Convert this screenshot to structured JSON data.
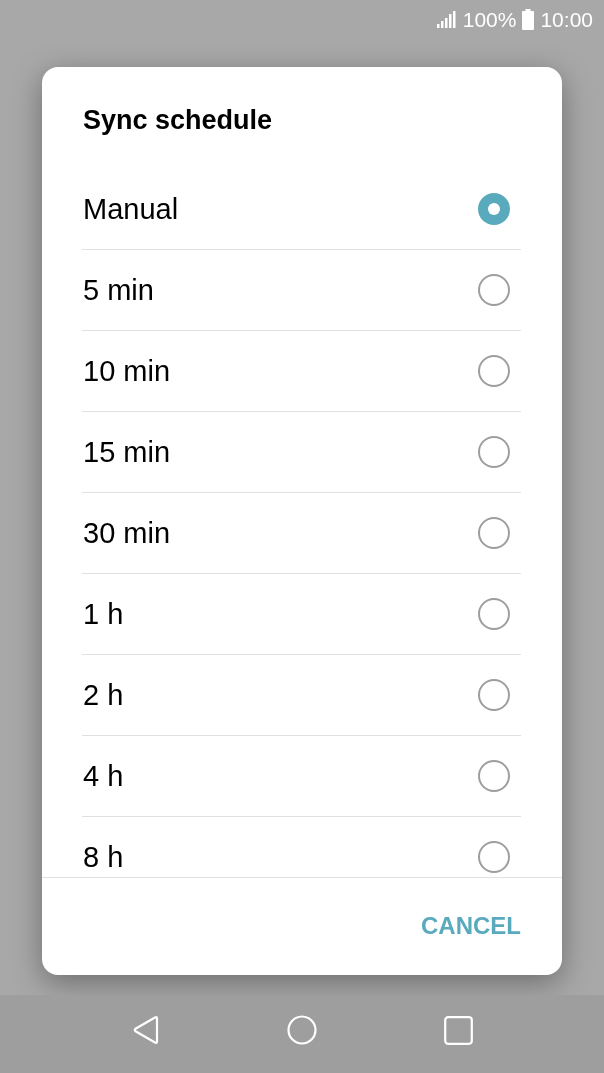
{
  "status_bar": {
    "battery": "100%",
    "time": "10:00"
  },
  "dialog": {
    "title": "Sync schedule",
    "options": [
      {
        "label": "Manual",
        "selected": true
      },
      {
        "label": "5 min",
        "selected": false
      },
      {
        "label": "10 min",
        "selected": false
      },
      {
        "label": "15 min",
        "selected": false
      },
      {
        "label": "30 min",
        "selected": false
      },
      {
        "label": "1 h",
        "selected": false
      },
      {
        "label": "2 h",
        "selected": false
      },
      {
        "label": "4 h",
        "selected": false
      },
      {
        "label": "8 h",
        "selected": false
      }
    ],
    "buttons": [
      {
        "label": "CANCEL"
      }
    ]
  }
}
